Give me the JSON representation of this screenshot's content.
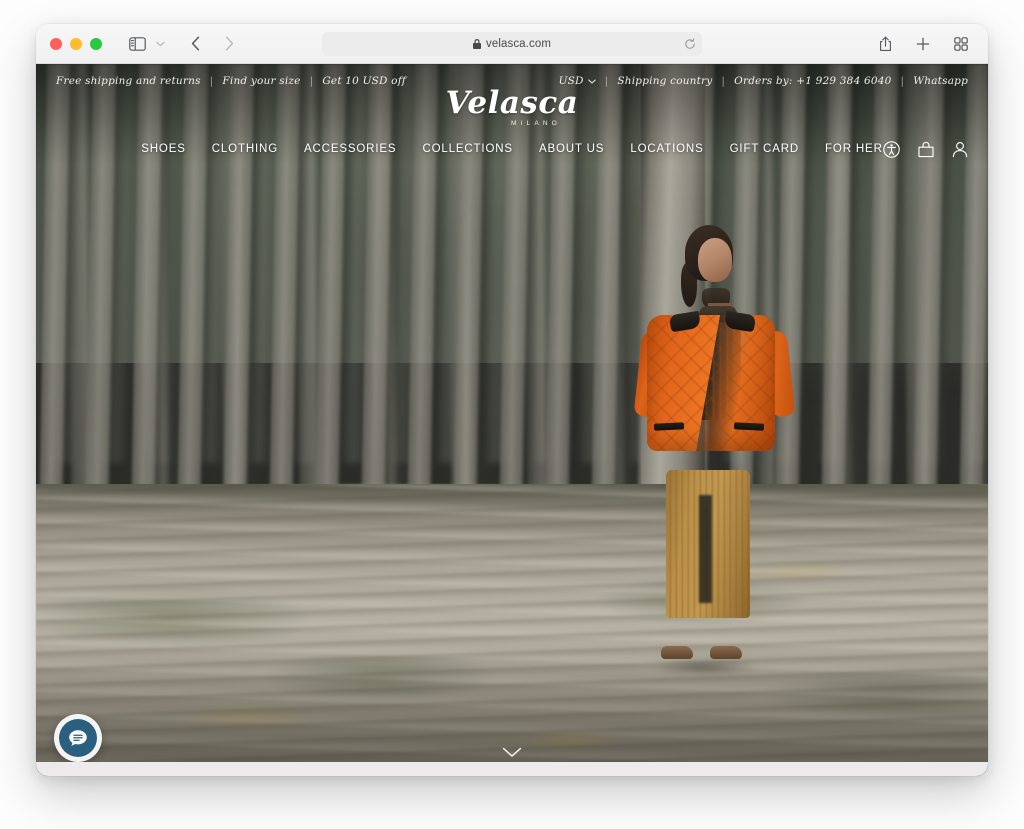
{
  "browser": {
    "toolbar": {
      "traffic_lights": [
        "close",
        "minimize",
        "maximize"
      ],
      "sidebar_icon": "sidebar-icon",
      "chevron_icon": "chevron-down-icon",
      "back_icon": "back-arrow-icon",
      "forward_icon": "forward-arrow-icon",
      "shield_icon": "privacy-shield-icon",
      "share_icon": "share-icon",
      "new_tab_icon": "plus-icon",
      "tab_overview_icon": "tab-overview-icon"
    },
    "address_bar": {
      "lock_icon": "lock-icon",
      "url": "velasca.com",
      "reload_icon": "reload-icon"
    }
  },
  "site": {
    "announcement": {
      "left_items": [
        "Free shipping and returns",
        "Find your size",
        "Get 10 USD off"
      ],
      "currency": "USD",
      "currency_chevron": "chevron-down-icon",
      "right_items": [
        "Shipping country",
        "Orders by: +1 929 384 6040",
        "Whatsapp"
      ],
      "separator": "|"
    },
    "logo": {
      "wordmark": "Velasca",
      "tagline": "MILANO"
    },
    "nav": [
      {
        "label": "SHOES"
      },
      {
        "label": "CLOTHING"
      },
      {
        "label": "ACCESSORIES"
      },
      {
        "label": "COLLECTIONS"
      },
      {
        "label": "ABOUT US"
      },
      {
        "label": "LOCATIONS"
      },
      {
        "label": "GIFT CARD"
      },
      {
        "label": "FOR HER"
      }
    ],
    "header_actions": [
      {
        "name": "accessibility-icon"
      },
      {
        "name": "shopping-bag-icon"
      },
      {
        "name": "account-icon"
      }
    ],
    "hero": {
      "description": "Man leaning against a poplar tree in a forest wearing an orange quilted jacket",
      "scroll_cue_icon": "chevron-down-icon"
    },
    "chat": {
      "icon": "chat-bubble-icon"
    },
    "colors": {
      "jacket_orange": "#e2661b",
      "trousers_tan": "#bb9048",
      "chat_blue": "#2b5f7f",
      "header_text": "#ffffff"
    }
  }
}
